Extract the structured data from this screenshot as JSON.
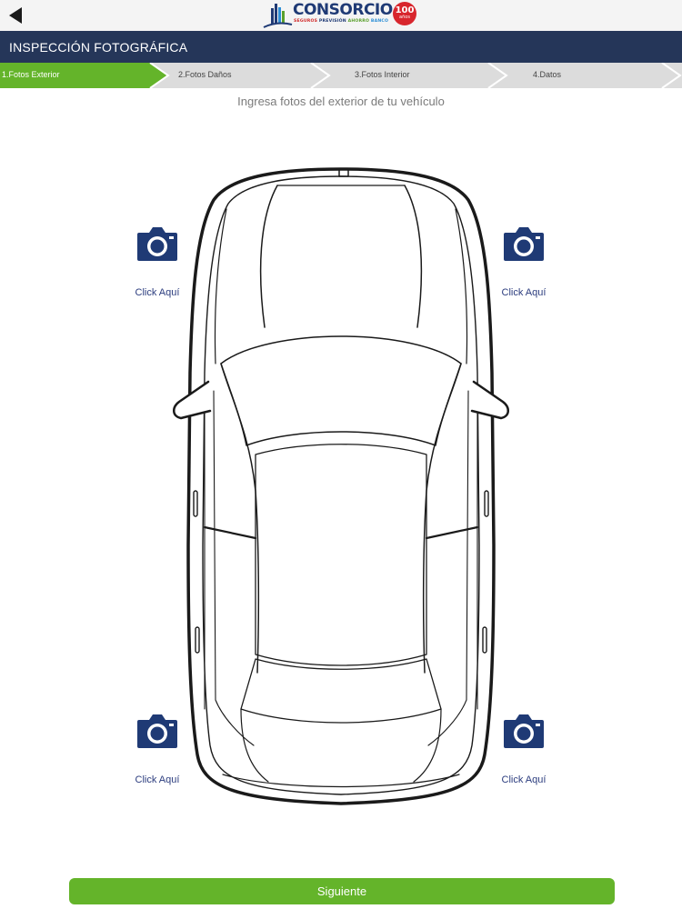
{
  "topbar": {
    "back_icon": "back-arrow-icon",
    "logo_text": "CONSORCIO",
    "logo_sub": [
      "SEGUROS",
      "PREVISIÓN",
      "AHORRO",
      "BANCO"
    ],
    "badge": "100",
    "badge_sub": "años"
  },
  "header": {
    "title": "INSPECCIÓN FOTOGRÁFICA"
  },
  "steps": [
    {
      "label": "1.Fotos Exterior",
      "active": true
    },
    {
      "label": "2.Fotos Daños",
      "active": false
    },
    {
      "label": "3.Fotos Interior",
      "active": false
    },
    {
      "label": "4.Datos",
      "active": false
    }
  ],
  "instruction": "Ingresa fotos del exterior de tu vehículo",
  "camera_buttons": [
    {
      "label": "Click Aquí",
      "icon": "camera-icon"
    },
    {
      "label": "Click Aquí",
      "icon": "camera-icon"
    },
    {
      "label": "Click Aquí",
      "icon": "camera-icon"
    },
    {
      "label": "Click Aquí",
      "icon": "camera-icon"
    }
  ],
  "next_button": {
    "label": "Siguiente"
  },
  "colors": {
    "header": "#253659",
    "active_step": "#64b42a",
    "button": "#64b42a",
    "link": "#2b3c7e",
    "camera": "#1f3a75"
  }
}
